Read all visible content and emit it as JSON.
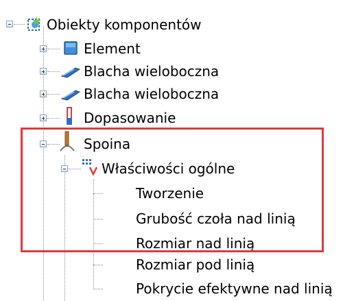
{
  "tree": {
    "root": {
      "label": "Obiekty komponentów",
      "icon": "component-objects-icon",
      "expanded": true
    },
    "items": [
      {
        "label": "Element",
        "icon": "element-icon",
        "expanded": false
      },
      {
        "label": "Blacha wieloboczna",
        "icon": "polygon-plate-icon",
        "expanded": false
      },
      {
        "label": "Blacha wieloboczna",
        "icon": "polygon-plate-icon",
        "expanded": false
      },
      {
        "label": "Dopasowanie",
        "icon": "fitting-icon",
        "expanded": false
      },
      {
        "label": "Spoina",
        "icon": "weld-icon",
        "expanded": true,
        "children": [
          {
            "label": "Właściwości ogólne",
            "icon": "general-properties-icon",
            "expanded": true,
            "children": [
              {
                "label": "Tworzenie"
              },
              {
                "label": "Grubość czoła nad linią"
              },
              {
                "label": "Rozmiar nad linią"
              },
              {
                "label": "Rozmiar pod linią"
              },
              {
                "label": "Pokrycie efektywne nad linią"
              }
            ]
          }
        ]
      }
    ]
  },
  "highlight": {
    "color": "#e0393e"
  }
}
